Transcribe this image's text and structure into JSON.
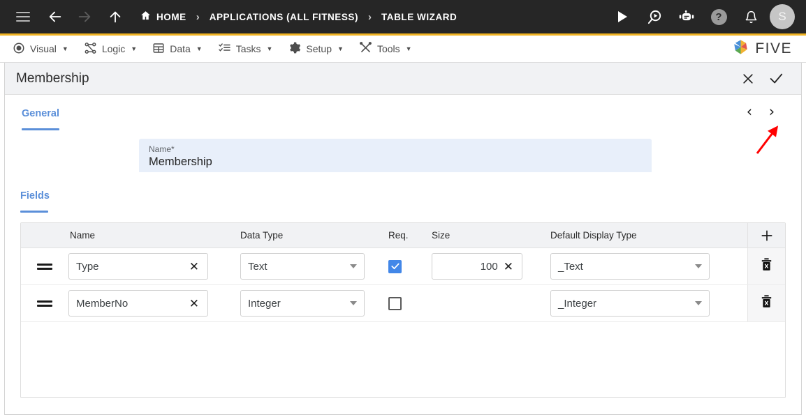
{
  "topbar": {
    "menu_icon": "hamburger-icon",
    "back_icon": "arrow-left-icon",
    "forward_icon": "arrow-right-icon",
    "up_icon": "arrow-up-icon",
    "home_icon": "home-icon",
    "breadcrumbs": [
      {
        "label": "HOME",
        "icon": "home-icon"
      },
      {
        "label": "APPLICATIONS (ALL FITNESS)",
        "icon": ""
      },
      {
        "label": "TABLE WIZARD",
        "icon": ""
      }
    ],
    "separator": "›",
    "actions": [
      {
        "name": "run-icon",
        "label": ""
      },
      {
        "name": "search-run-icon",
        "label": ""
      },
      {
        "name": "chat-bot-icon",
        "label": ""
      },
      {
        "name": "help-icon",
        "label": "?"
      },
      {
        "name": "notifications-bell-icon",
        "label": ""
      }
    ],
    "avatar_initial": "S",
    "accent_color": "#f0b323",
    "bg_color": "#262626"
  },
  "menubar": {
    "items": [
      {
        "label": "Visual",
        "icon": "eye-icon",
        "caret": "▼"
      },
      {
        "label": "Logic",
        "icon": "flow-nodes-icon",
        "caret": "▼"
      },
      {
        "label": "Data",
        "icon": "table-grid-icon",
        "caret": "▼"
      },
      {
        "label": "Tasks",
        "icon": "checklist-icon",
        "caret": "▼"
      },
      {
        "label": "Setup",
        "icon": "gear-icon",
        "caret": "▼"
      },
      {
        "label": "Tools",
        "icon": "wrench-screwdriver-icon",
        "caret": "▼"
      }
    ],
    "logo_text": "FIVE"
  },
  "panel": {
    "title": "Membership",
    "close_label": "✕",
    "confirm_label": "✓",
    "tabs": [
      {
        "label": "General",
        "active": true
      }
    ],
    "nav_prev": "‹",
    "nav_next": "›",
    "name_field": {
      "label": "Name",
      "required_mark": "*",
      "value": "Membership",
      "bg_color": "#e8effa"
    },
    "fields_section": {
      "tab_label": "Fields",
      "add_label": "+",
      "columns": [
        "",
        "Name",
        "Data Type",
        "Req.",
        "Size",
        "Default Display Type",
        ""
      ],
      "rows": [
        {
          "handle": "drag-handle-icon",
          "name": "Type",
          "name_clear": "✕",
          "data_type": "Text",
          "required": true,
          "size": "100",
          "size_clear": "✕",
          "default_display_type": "_Text",
          "delete": "delete-row-icon"
        },
        {
          "handle": "drag-handle-icon",
          "name": "MemberNo",
          "name_clear": "✕",
          "data_type": "Integer",
          "required": false,
          "size": "",
          "size_clear": "",
          "default_display_type": "_Integer",
          "delete": "delete-row-icon"
        }
      ]
    }
  },
  "annotation": {
    "arrow_color": "#ff0000",
    "points_at": "next-record-button"
  },
  "colors": {
    "accent_blue": "#5b8fd9",
    "checkbox_blue": "#4287e8",
    "header_gray": "#f1f2f4"
  }
}
